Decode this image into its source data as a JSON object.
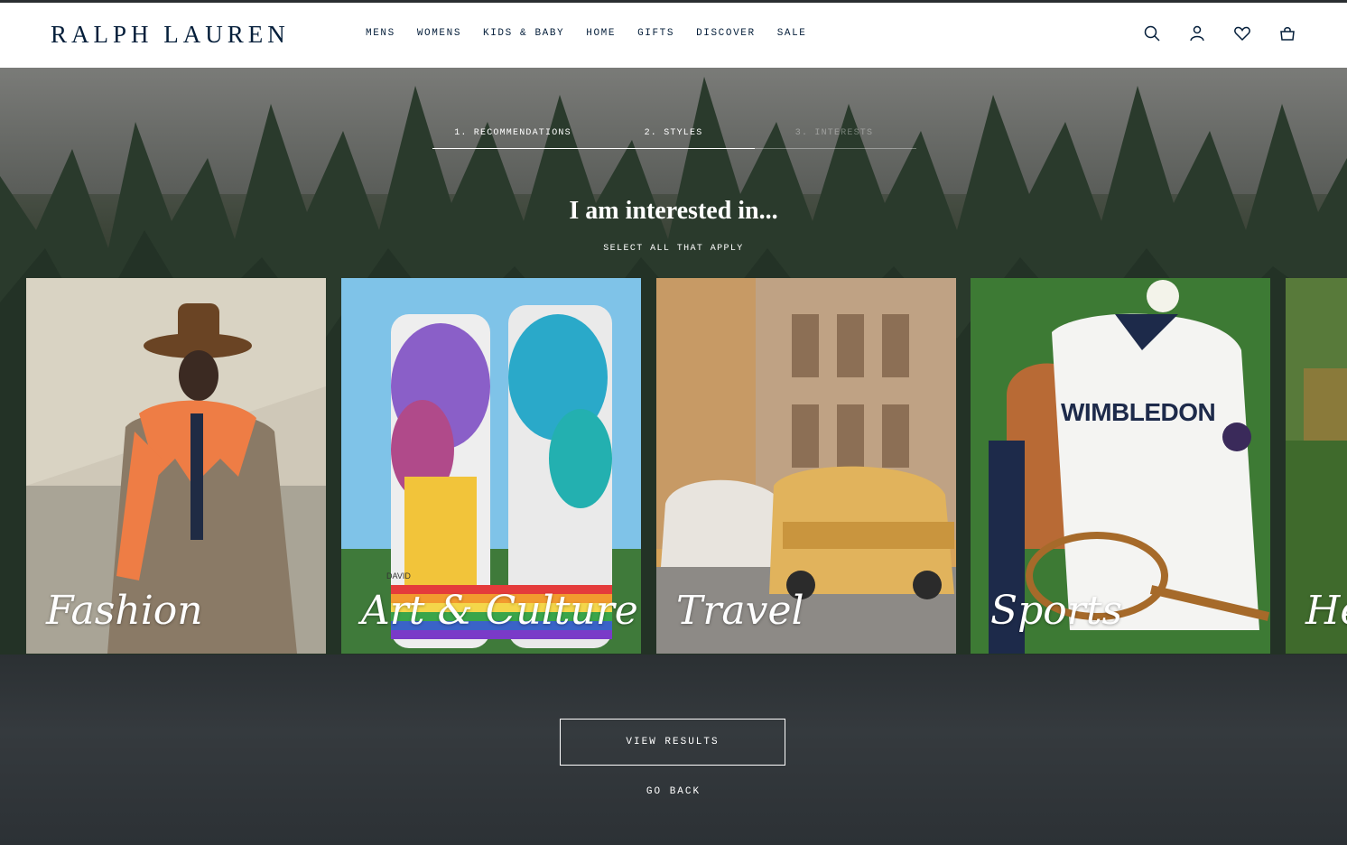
{
  "brand": {
    "logo": "RALPH LAUREN"
  },
  "nav": {
    "items": [
      "MENS",
      "WOMENS",
      "KIDS & BABY",
      "HOME",
      "GIFTS",
      "DISCOVER",
      "SALE"
    ]
  },
  "header_icons": [
    "search-icon",
    "account-icon",
    "wishlist-heart-icon",
    "shopping-bag-icon"
  ],
  "steps": [
    {
      "label": "1. RECOMMENDATIONS",
      "state": "complete"
    },
    {
      "label": "2. STYLES",
      "state": "complete"
    },
    {
      "label": "3. INTERESTS",
      "state": "current"
    }
  ],
  "quiz": {
    "headline": "I am interested in...",
    "subtitle": "SELECT ALL THAT APPLY"
  },
  "cards": [
    {
      "label": "Fashion",
      "selected": false
    },
    {
      "label": "Art & Culture",
      "selected": true
    },
    {
      "label": "Travel",
      "selected": false
    },
    {
      "label": "Sports",
      "selected": false
    },
    {
      "label": "He",
      "selected": false
    }
  ],
  "card_overlay": {
    "wimbledon": "WIMBLEDON",
    "mural": "DAVID"
  },
  "actions": {
    "view_results": "VIEW RESULTS",
    "go_back": "GO BACK"
  },
  "colors": {
    "navy": "#041e3a",
    "white": "#ffffff"
  }
}
